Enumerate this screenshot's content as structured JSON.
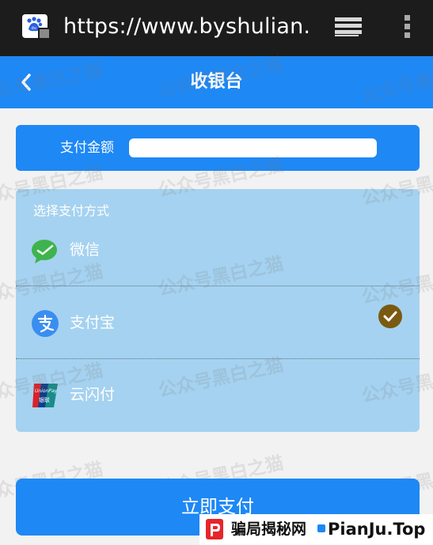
{
  "browser": {
    "url": "https://www.byshulian.co",
    "site_icon": "baidu-paw-icon",
    "lock_icon": "lock-icon",
    "tabs_icon": "tabs-stack-icon",
    "menu_icon": "kebab-menu-icon"
  },
  "header": {
    "title": "收银台",
    "back_icon": "chevron-left-icon"
  },
  "amount": {
    "label": "支付金额",
    "value": ""
  },
  "payment": {
    "heading": "选择支付方式",
    "options": [
      {
        "label": "微信",
        "icon": "wechat-icon",
        "selected": false
      },
      {
        "label": "支付宝",
        "icon": "alipay-icon",
        "selected": true
      },
      {
        "label": "云闪付",
        "icon": "unionpay-icon",
        "selected": false
      }
    ]
  },
  "pay_button": {
    "label": "立即支付"
  },
  "watermark": {
    "text": "公众号黑白之猫"
  },
  "badge": {
    "cn": "骗局揭秘网",
    "en": "PianJu.Top"
  },
  "colors": {
    "accent": "#1e88f5",
    "panel": "#a5d2f0",
    "check": "#7a5a10",
    "browser_bar": "#1c1c1c"
  }
}
